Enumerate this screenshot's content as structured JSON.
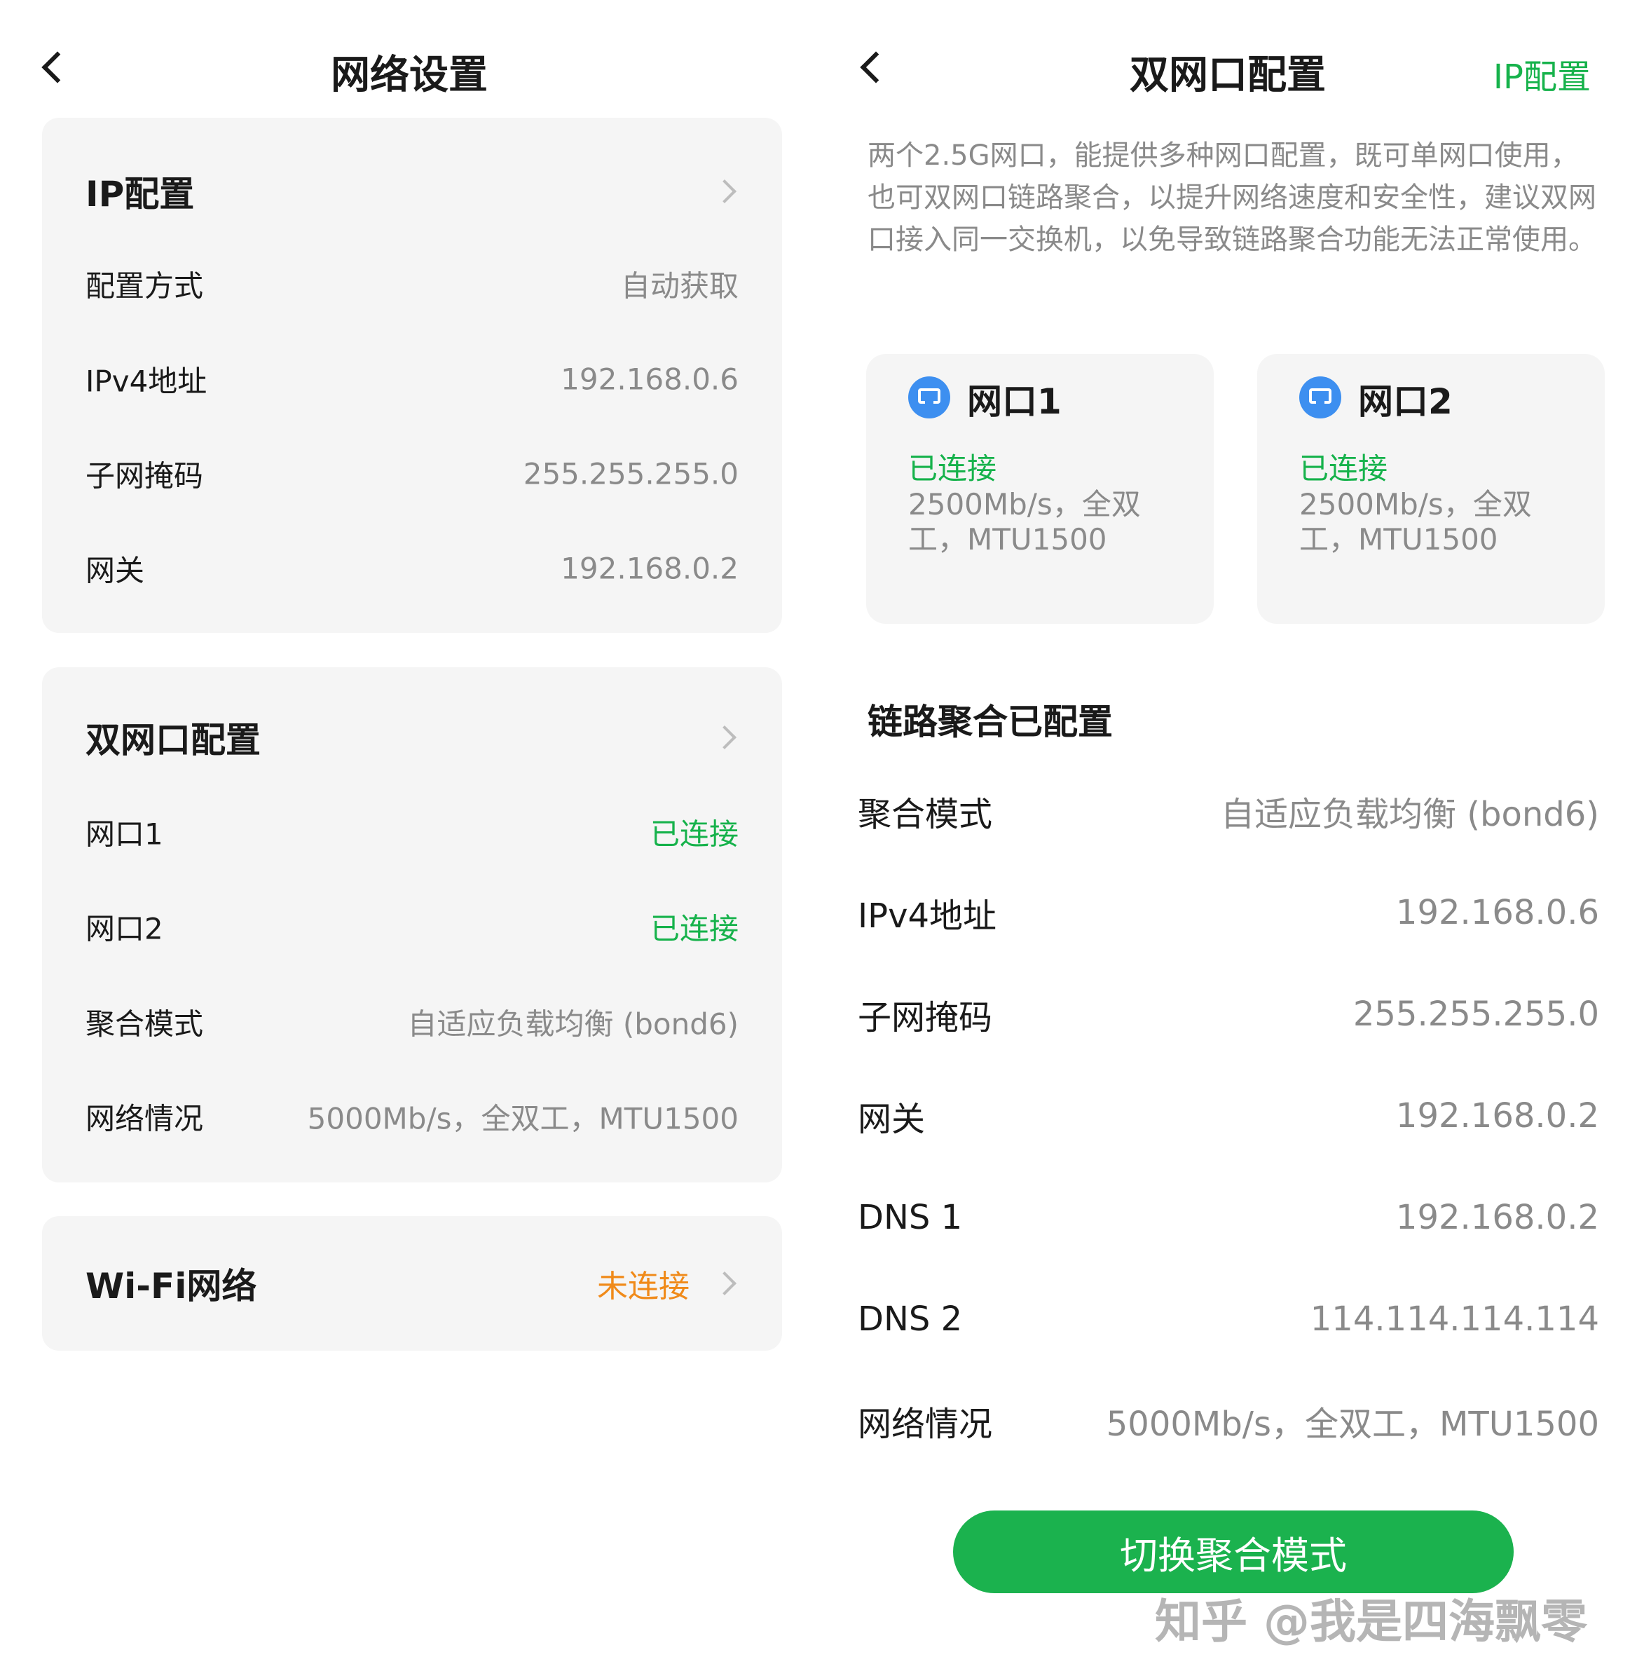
{
  "left": {
    "title": "网络设置",
    "ip_card": {
      "header": "IP配置",
      "rows": [
        {
          "label": "配置方式",
          "value": "自动获取"
        },
        {
          "label": "IPv4地址",
          "value": "192.168.0.6"
        },
        {
          "label": "子网掩码",
          "value": "255.255.255.0"
        },
        {
          "label": "网关",
          "value": "192.168.0.2"
        }
      ]
    },
    "dual_card": {
      "header": "双网口配置",
      "rows": [
        {
          "label": "网口1",
          "value": "已连接"
        },
        {
          "label": "网口2",
          "value": "已连接"
        },
        {
          "label": "聚合模式",
          "value": "自适应负载均衡 (bond6)"
        },
        {
          "label": "网络情况",
          "value": "5000Mb/s，全双工，MTU1500"
        }
      ]
    },
    "wifi_card": {
      "label": "Wi-Fi网络",
      "value": "未连接"
    }
  },
  "right": {
    "title": "双网口配置",
    "top_link": "IP配置",
    "description": "两个2.5G网口，能提供多种网口配置，既可单网口使用，也可双网口链路聚合，以提升网络速度和安全性，建议双网口接入同一交换机，以免导致链路聚合功能无法正常使用。",
    "ports": [
      {
        "name": "网口1",
        "status": "已连接",
        "detail": "2500Mb/s，全双工，MTU1500"
      },
      {
        "name": "网口2",
        "status": "已连接",
        "detail": "2500Mb/s，全双工，MTU1500"
      }
    ],
    "section_title": "链路聚合已配置",
    "rows": [
      {
        "label": "聚合模式",
        "value": "自适应负载均衡 (bond6)"
      },
      {
        "label": "IPv4地址",
        "value": "192.168.0.6"
      },
      {
        "label": "子网掩码",
        "value": "255.255.255.0"
      },
      {
        "label": "网关",
        "value": "192.168.0.2"
      },
      {
        "label": "DNS 1",
        "value": "192.168.0.2"
      },
      {
        "label": "DNS 2",
        "value": "114.114.114.114"
      },
      {
        "label": "网络情况",
        "value": "5000Mb/s，全双工，MTU1500"
      }
    ],
    "action_button": "切换聚合模式",
    "watermark": "知乎 @我是四海飘零"
  },
  "colors": {
    "accent_green": "#16b24b",
    "warning_orange": "#f08a19",
    "card_bg": "#f5f5f5",
    "port_icon_blue": "#3d8ff0"
  },
  "icons": [
    "back-arrow-icon",
    "chevron-right-icon",
    "ethernet-port-icon"
  ]
}
